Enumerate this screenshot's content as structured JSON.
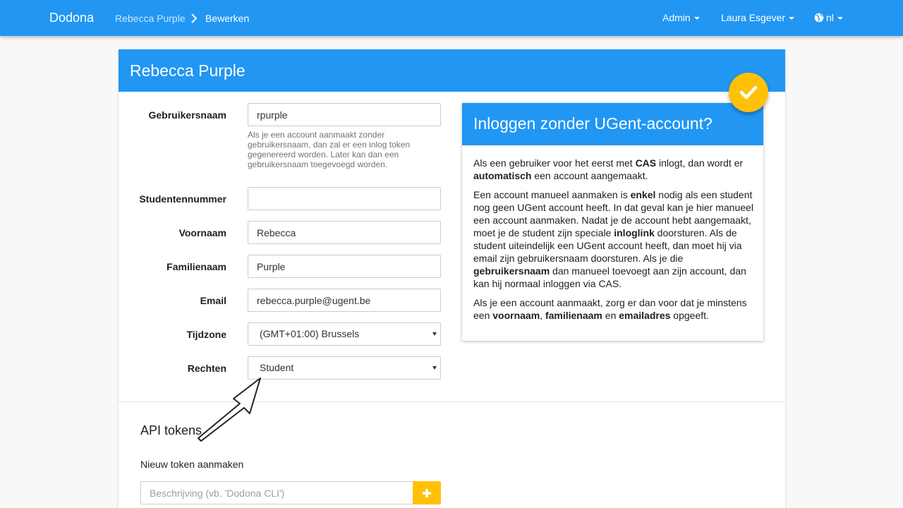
{
  "navbar": {
    "brand": "Dodona",
    "breadcrumb": [
      "Rebecca Purple",
      "Bewerken"
    ],
    "admin_label": "Admin",
    "user_label": "Laura Esgever",
    "lang_label": "nl"
  },
  "page": {
    "title": "Rebecca Purple"
  },
  "form": {
    "username": {
      "label": "Gebruikersnaam",
      "value": "rpurple",
      "help": "Als je een account aanmaakt zonder gebruikersnaam, dan zal er een inlog token gegenereerd worden. Later kan dan een gebruikersnaam toegevoegd worden."
    },
    "student_number": {
      "label": "Studentennummer",
      "value": ""
    },
    "first_name": {
      "label": "Voornaam",
      "value": "Rebecca"
    },
    "last_name": {
      "label": "Familienaam",
      "value": "Purple"
    },
    "email": {
      "label": "Email",
      "value": "rebecca.purple@ugent.be"
    },
    "timezone": {
      "label": "Tijdzone",
      "value": "(GMT+01:00) Brussels"
    },
    "permission": {
      "label": "Rechten",
      "value": "Student"
    }
  },
  "info": {
    "title": "Inloggen zonder UGent-account?",
    "p1": {
      "a": "Als een gebruiker voor het eerst met ",
      "b1": "CAS",
      "c": " inlogt, dan wordt er ",
      "b2": "automatisch",
      "d": " een account aangemaakt."
    },
    "p2": {
      "a": "Een account manueel aanmaken is ",
      "b1": "enkel",
      "c": " nodig als een student nog geen UGent account heeft. In dat geval kan je hier manueel een account aanmaken. Nadat je de account hebt aangemaakt, moet je de student zijn speciale ",
      "b2": "inloglink",
      "d": " doorsturen. Als de student uiteindelijk een UGent account heeft, dan moet hij via email zijn gebruikersnaam doorsturen. Als je die ",
      "b3": "gebruikersnaam",
      "e": " dan manueel toevoegt aan zijn account, dan kan hij normaal inloggen via CAS."
    },
    "p3": {
      "a": "Als je een account aanmaakt, zorg er dan voor dat je minstens een ",
      "b1": "voornaam",
      "c": ", ",
      "b2": "familienaam",
      "d": " en ",
      "b3": "emailadres",
      "e": " opgeeft."
    }
  },
  "api": {
    "title": "API tokens",
    "new_token_label": "Nieuw token aanmaken",
    "placeholder": "Beschrijving (vb. 'Dodona CLI')"
  },
  "colors": {
    "primary": "#2196f3",
    "accent": "#ffc107"
  }
}
